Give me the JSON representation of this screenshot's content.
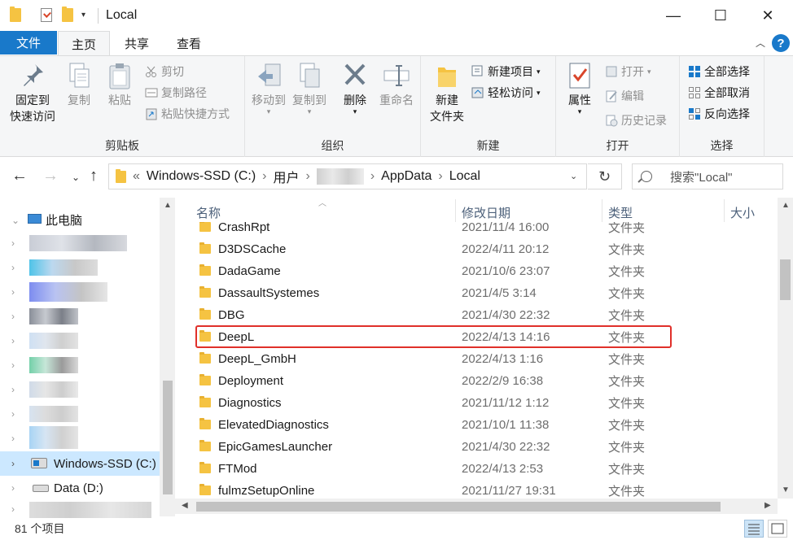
{
  "window": {
    "title": "Local",
    "controls": {
      "minimize": "—",
      "maximize": "☐",
      "close": "✕"
    }
  },
  "ribbon_tabs": {
    "file": "文件",
    "home": "主页",
    "share": "共享",
    "view": "查看",
    "help": "?"
  },
  "ribbon": {
    "clipboard": {
      "label": "剪贴板",
      "pin_line1": "固定到",
      "pin_line2": "快速访问",
      "copy": "复制",
      "paste": "粘贴",
      "cut": "剪切",
      "copy_path": "复制路径",
      "paste_shortcut": "粘贴快捷方式"
    },
    "organize": {
      "label": "组织",
      "move_to": "移动到",
      "copy_to": "复制到",
      "delete": "删除",
      "rename": "重命名"
    },
    "new": {
      "label": "新建",
      "new_folder_line1": "新建",
      "new_folder_line2": "文件夹",
      "new_item": "新建项目",
      "easy_access": "轻松访问"
    },
    "open": {
      "label": "打开",
      "properties": "属性",
      "open": "打开",
      "edit": "编辑",
      "history": "历史记录"
    },
    "select": {
      "label": "选择",
      "select_all": "全部选择",
      "select_none": "全部取消",
      "invert": "反向选择"
    }
  },
  "address": {
    "prefix": "«",
    "segments": [
      "Windows-SSD (C:)",
      "用户",
      "AppData",
      "Local"
    ],
    "separator": "›",
    "search_placeholder": "搜索\"Local\""
  },
  "nav": {
    "this_pc": "此电脑",
    "drive_c": "Windows-SSD (C:)",
    "drive_d": "Data (D:)"
  },
  "columns": {
    "name": "名称",
    "date": "修改日期",
    "type": "类型",
    "size": "大小"
  },
  "files": [
    {
      "name": "CrashRpt",
      "date": "2021/11/4 16:00",
      "type": "文件夹"
    },
    {
      "name": "D3DSCache",
      "date": "2022/4/11 20:12",
      "type": "文件夹"
    },
    {
      "name": "DadaGame",
      "date": "2021/10/6 23:07",
      "type": "文件夹"
    },
    {
      "name": "DassaultSystemes",
      "date": "2021/4/5 3:14",
      "type": "文件夹"
    },
    {
      "name": "DBG",
      "date": "2021/4/30 22:32",
      "type": "文件夹"
    },
    {
      "name": "DeepL",
      "date": "2022/4/13 14:16",
      "type": "文件夹"
    },
    {
      "name": "DeepL_GmbH",
      "date": "2022/4/13 1:16",
      "type": "文件夹"
    },
    {
      "name": "Deployment",
      "date": "2022/2/9 16:38",
      "type": "文件夹"
    },
    {
      "name": "Diagnostics",
      "date": "2021/11/12 1:12",
      "type": "文件夹"
    },
    {
      "name": "ElevatedDiagnostics",
      "date": "2021/10/1 11:38",
      "type": "文件夹"
    },
    {
      "name": "EpicGamesLauncher",
      "date": "2021/4/30 22:32",
      "type": "文件夹"
    },
    {
      "name": "FTMod",
      "date": "2022/4/13 2:53",
      "type": "文件夹"
    },
    {
      "name": "fulmzSetupOnline",
      "date": "2021/11/27 19:31",
      "type": "文件夹"
    }
  ],
  "status": {
    "count": "81 个项目"
  }
}
